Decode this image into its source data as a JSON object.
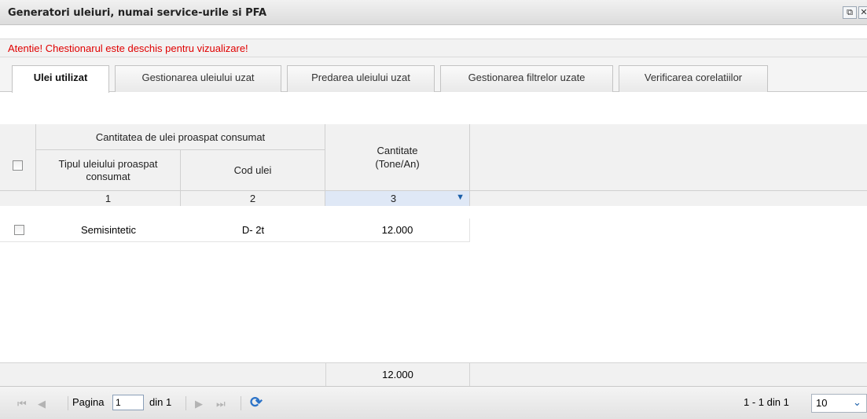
{
  "window": {
    "title": "Generatori uleiuri, numai service-urile si PFA",
    "restore_glyph": "⧉",
    "close_glyph": "✕"
  },
  "warning": "Atentie! Chestionarul este deschis pentru vizualizare!",
  "tabs": [
    {
      "label": "Ulei utilizat",
      "active": true
    },
    {
      "label": "Gestionarea uleiului uzat",
      "active": false
    },
    {
      "label": "Predarea uleiului uzat",
      "active": false
    },
    {
      "label": "Gestionarea filtrelor uzate",
      "active": false
    },
    {
      "label": "Verificarea corelatiilor",
      "active": false
    }
  ],
  "grid": {
    "group_header": "Cantitatea de ulei proaspat consumat",
    "columns": [
      "Tipul uleiului proaspat consumat",
      "Cod ulei",
      "Cantitate (Tone/An)"
    ],
    "column_numbers": [
      "1",
      "2",
      "3"
    ],
    "rows": [
      {
        "tip": "Semisintetic",
        "cod": "D- 2t",
        "cantitate": "12.000"
      }
    ],
    "total": "12.000"
  },
  "pager": {
    "page_label": "Pagina",
    "page_value": "1",
    "of_label": "din 1",
    "range_text": "1 - 1 din 1",
    "page_size": "10"
  },
  "colors": {
    "warning": "#e00000",
    "selected_col": "#dfe8f6"
  },
  "icons": [
    "first-page-icon",
    "prev-page-icon",
    "next-page-icon",
    "last-page-icon",
    "refresh-icon",
    "chevron-down-icon"
  ]
}
